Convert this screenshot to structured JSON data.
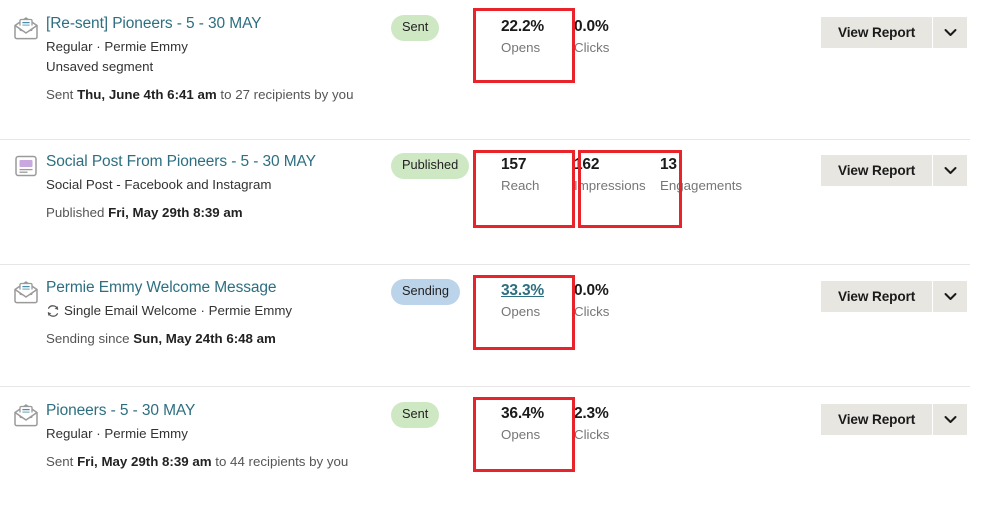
{
  "rows": [
    {
      "id": "resent-pioneers",
      "icon": "email-open-icon",
      "title": "[Re-sent] Pioneers - 5 - 30 MAY",
      "meta": "Regular · Permie Emmy",
      "meta2": "Unsaved segment",
      "recurring": false,
      "sent_prefix": "Sent ",
      "sent_bold": "Thu, June 4th 6:41 am",
      "sent_suffix": " to 27 recipients by you",
      "status": {
        "label": "Sent",
        "style": "sent",
        "color": "#cfe8c4"
      },
      "stats": [
        {
          "value": "22.2%",
          "label": "Opens",
          "link": false,
          "highlighted": true
        },
        {
          "value": "0.0%",
          "label": "Clicks",
          "link": false,
          "highlighted": false
        }
      ],
      "action": {
        "label": "View Report",
        "caret": "chevron-down-icon"
      }
    },
    {
      "id": "social-post-pioneers",
      "icon": "social-post-icon",
      "title": "Social Post From Pioneers - 5 - 30 MAY",
      "meta": "Social Post - Facebook and Instagram",
      "meta2": "",
      "recurring": false,
      "sent_prefix": "Published ",
      "sent_bold": "Fri, May 29th 8:39 am",
      "sent_suffix": "",
      "status": {
        "label": "Published",
        "style": "published",
        "color": "#cfe8c4"
      },
      "stats": [
        {
          "value": "157",
          "label": "Reach",
          "link": false,
          "highlighted": true
        },
        {
          "value": "162",
          "label": "Impressions",
          "link": false,
          "highlighted": true
        },
        {
          "value": "13",
          "label": "Engagements",
          "link": false,
          "highlighted": false
        }
      ],
      "action": {
        "label": "View Report",
        "caret": "chevron-down-icon"
      }
    },
    {
      "id": "permie-emmy-welcome",
      "icon": "email-open-icon",
      "title": "Permie Emmy Welcome Message",
      "meta": "Single Email Welcome · Permie Emmy",
      "meta2": "",
      "recurring": true,
      "sent_prefix": "Sending since ",
      "sent_bold": "Sun, May 24th 6:48 am",
      "sent_suffix": "",
      "status": {
        "label": "Sending",
        "style": "sending",
        "color": "#bcd4ea"
      },
      "stats": [
        {
          "value": "33.3%",
          "label": "Opens",
          "link": true,
          "highlighted": true
        },
        {
          "value": "0.0%",
          "label": "Clicks",
          "link": false,
          "highlighted": false
        }
      ],
      "action": {
        "label": "View Report",
        "caret": "chevron-down-icon"
      }
    },
    {
      "id": "pioneers-5-30-may",
      "icon": "email-open-icon",
      "title": "Pioneers - 5 - 30 MAY",
      "meta": "Regular · Permie Emmy",
      "meta2": "",
      "recurring": false,
      "sent_prefix": "Sent ",
      "sent_bold": "Fri, May 29th 8:39 am",
      "sent_suffix": " to 44 recipients by you",
      "status": {
        "label": "Sent",
        "style": "sent",
        "color": "#cfe8c4"
      },
      "stats": [
        {
          "value": "36.4%",
          "label": "Opens",
          "link": false,
          "highlighted": true
        },
        {
          "value": "2.3%",
          "label": "Clicks",
          "link": false,
          "highlighted": false
        }
      ],
      "action": {
        "label": "View Report",
        "caret": "chevron-down-icon"
      }
    }
  ],
  "annotation": {
    "color": "#e8232a",
    "border_width": 3
  },
  "theme": {
    "link_color": "#2d6f80",
    "text_color": "#1a1a1a",
    "muted_color": "#767676",
    "button_bg": "#e8e6e1",
    "divider": "#e6e6e6"
  }
}
